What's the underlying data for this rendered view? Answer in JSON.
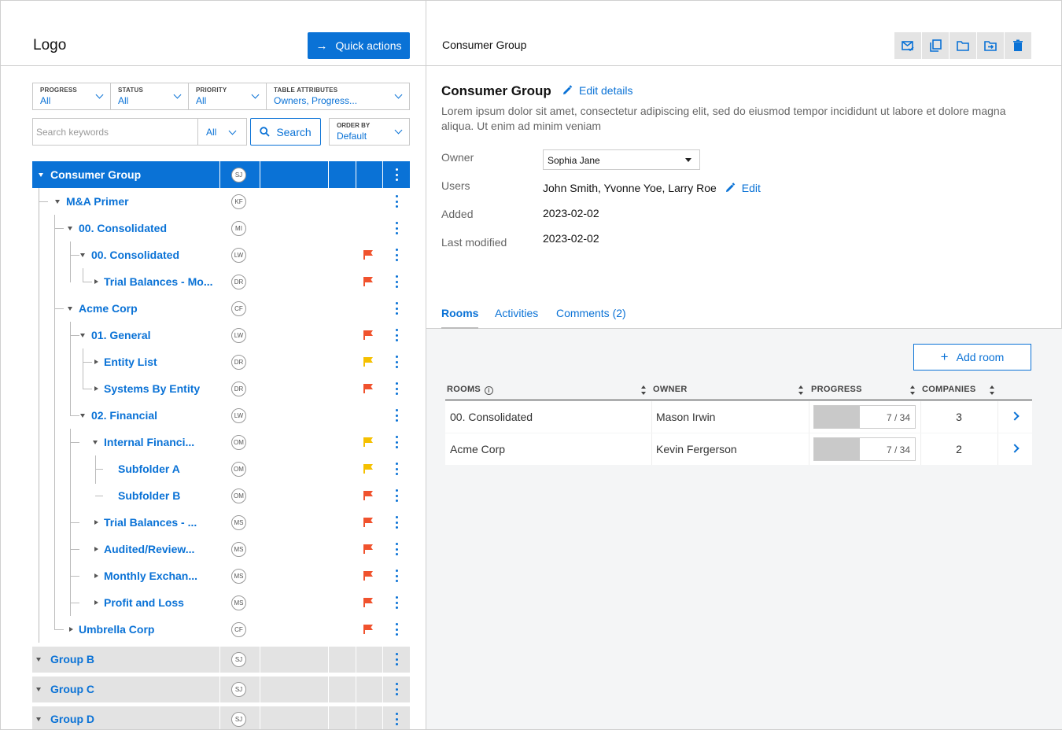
{
  "header": {
    "logo": "Logo",
    "quick_actions": "Quick actions"
  },
  "filters": [
    {
      "label": "PROGRESS",
      "value": "All"
    },
    {
      "label": "STATUS",
      "value": "All"
    },
    {
      "label": "PRIORITY",
      "value": "All"
    },
    {
      "label": "TABLE ATTRIBUTES",
      "value": "Owners, Progress..."
    }
  ],
  "search": {
    "placeholder": "Search keywords",
    "scope": "All",
    "button": "Search",
    "order_label": "ORDER BY",
    "order_value": "Default"
  },
  "tree": [
    {
      "name": "Consumer Group",
      "avatar": "SJ",
      "flag": "",
      "state": "open",
      "level": 0
    },
    {
      "name": "M&A Primer",
      "avatar": "KF",
      "flag": "",
      "state": "open",
      "level": 1
    },
    {
      "name": "00. Consolidated",
      "avatar": "MI",
      "flag": "",
      "state": "open",
      "level": 2
    },
    {
      "name": "00. Consolidated",
      "avatar": "LW",
      "flag": "red",
      "state": "open",
      "level": 3
    },
    {
      "name": "Trial Balances - Mo...",
      "avatar": "DR",
      "flag": "red",
      "state": "closed",
      "level": 4
    },
    {
      "name": "Acme Corp",
      "avatar": "CF",
      "flag": "",
      "state": "open",
      "level": 2
    },
    {
      "name": "01. General",
      "avatar": "LW",
      "flag": "red",
      "state": "open",
      "level": 3
    },
    {
      "name": "Entity List",
      "avatar": "DR",
      "flag": "yellow",
      "state": "closed",
      "level": 4
    },
    {
      "name": "Systems By Entity",
      "avatar": "DR",
      "flag": "red",
      "state": "closed",
      "level": 4
    },
    {
      "name": "02. Financial",
      "avatar": "LW",
      "flag": "",
      "state": "open",
      "level": 3
    },
    {
      "name": "Internal Financi...",
      "avatar": "OM",
      "flag": "yellow",
      "state": "open",
      "level": 4
    },
    {
      "name": "Subfolder A",
      "avatar": "OM",
      "flag": "yellow",
      "state": "none",
      "level": 5
    },
    {
      "name": "Subfolder B",
      "avatar": "OM",
      "flag": "red",
      "state": "none",
      "level": 5
    },
    {
      "name": "Trial Balances - ...",
      "avatar": "MS",
      "flag": "red",
      "state": "closed",
      "level": 4
    },
    {
      "name": "Audited/Review...",
      "avatar": "MS",
      "flag": "red",
      "state": "closed",
      "level": 4
    },
    {
      "name": "Monthly Exchan...",
      "avatar": "MS",
      "flag": "red",
      "state": "closed",
      "level": 4
    },
    {
      "name": "Profit and Loss",
      "avatar": "MS",
      "flag": "red",
      "state": "closed",
      "level": 4
    },
    {
      "name": "Umbrella Corp",
      "avatar": "CF",
      "flag": "red",
      "state": "closed",
      "level": 2
    }
  ],
  "groups": [
    {
      "name": "Group B",
      "avatar": "SJ"
    },
    {
      "name": "Group C",
      "avatar": "SJ"
    },
    {
      "name": "Group D",
      "avatar": "SJ"
    }
  ],
  "detail": {
    "header_title": "Consumer Group",
    "title": "Consumer Group",
    "edit_details": "Edit details",
    "description": "Lorem ipsum dolor sit amet, consectetur adipiscing elit, sed do eiusmod tempor incididunt ut labore et dolore magna aliqua. Ut enim ad minim veniam",
    "owner_label": "Owner",
    "owner_value": "Sophia Jane",
    "users_label": "Users",
    "users_value": "John Smith, Yvonne Yoe, Larry Roe",
    "users_edit": "Edit",
    "added_label": "Added",
    "added_value": "2023-02-02",
    "modified_label": "Last modified",
    "modified_value": "2023-02-02"
  },
  "tabs": [
    "Rooms",
    "Activities",
    "Comments (2)"
  ],
  "rooms": {
    "add_label": "Add room",
    "columns": [
      "ROOMS",
      "OWNER",
      "PROGRESS",
      "COMPANIES"
    ],
    "rows": [
      {
        "name": "00. Consolidated",
        "owner": "Mason Irwin",
        "progress_text": "7 / 34",
        "progress": 0.45,
        "companies": "3"
      },
      {
        "name": "Acme Corp",
        "owner": "Kevin Fergerson",
        "progress_text": "7 / 34",
        "progress": 0.45,
        "companies": "2"
      }
    ]
  },
  "colors": {
    "accent": "#0a72d6",
    "flag_red": "#f0522d",
    "flag_yellow": "#f5c000",
    "selected_row": "#0a72d6",
    "group_row": "#e3e3e3"
  },
  "icons": [
    "arrow-right-icon",
    "search-icon",
    "mail-icon",
    "copy-icon",
    "folder-icon",
    "move-folder-icon",
    "trash-icon",
    "pencil-icon",
    "plus-icon",
    "info-icon",
    "chevron-right-icon",
    "kebab-icon",
    "flag-icon"
  ]
}
